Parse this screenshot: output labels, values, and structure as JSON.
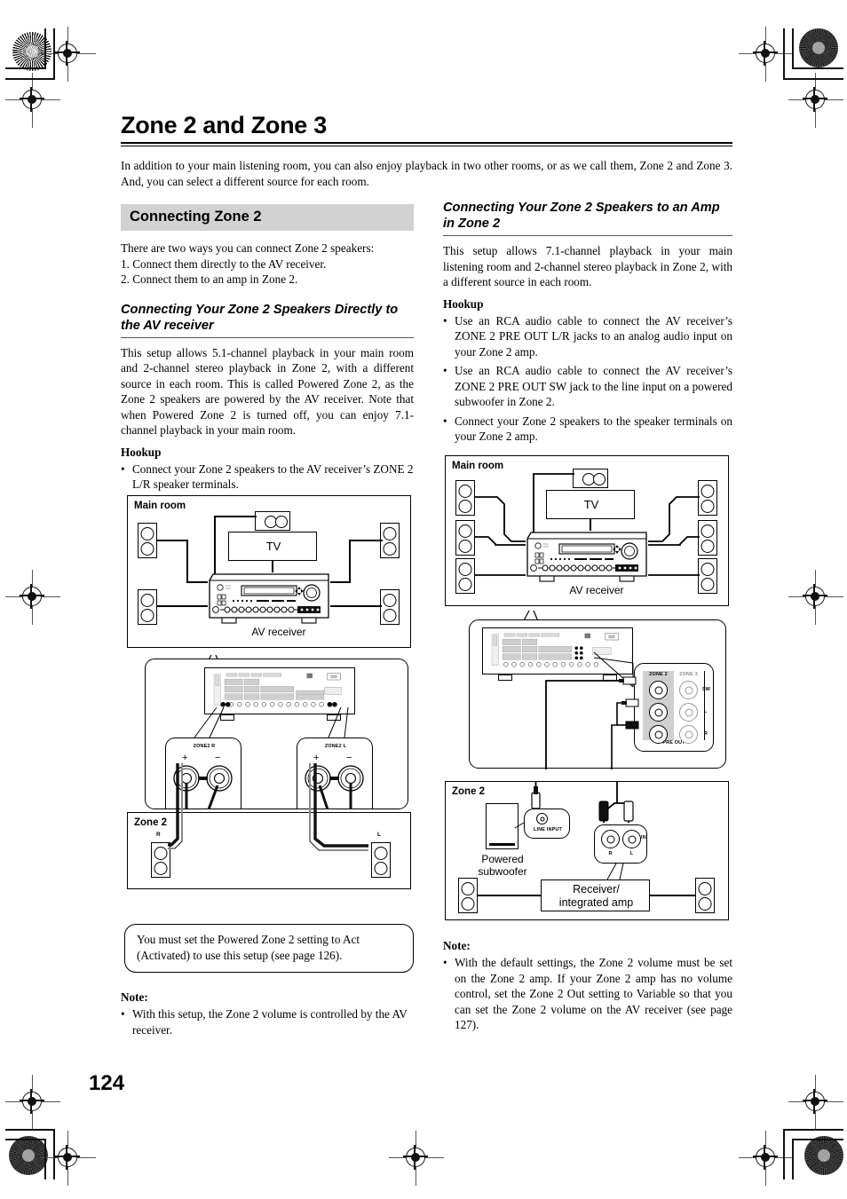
{
  "page": {
    "number": "124",
    "title": "Zone 2 and Zone 3",
    "intro": "In addition to your main listening room, you can also enjoy playback in two other rooms, or as we call them, Zone 2 and Zone 3. And, you can select a different source for each room."
  },
  "left_column": {
    "section_heading": "Connecting Zone 2",
    "intro_line": "There are two ways you can connect Zone 2 speakers:",
    "list": [
      "1. Connect them directly to the AV receiver.",
      "2. Connect them to an amp in Zone 2."
    ],
    "subheading": "Connecting Your Zone 2 Speakers Directly to the AV receiver",
    "body": "This setup allows 5.1-channel playback in your main room and 2-channel stereo playback in Zone 2, with a different source in each room. This is called Powered Zone 2, as the Zone 2 speakers are powered by the AV receiver. Note that when Powered Zone 2 is turned off, you can enjoy 7.1-channel playback in your main room.",
    "hookup_label": "Hookup",
    "hookup_items": [
      "Connect your Zone 2 speakers to the AV receiver’s ZONE 2 L/R speaker terminals."
    ],
    "callout": "You must set the Powered Zone 2 setting to Act (Activated) to use this setup (see page 126).",
    "note_label": "Note:",
    "note_items": [
      "With this setup, the Zone 2 volume is controlled by the AV receiver."
    ]
  },
  "right_column": {
    "subheading": "Connecting Your Zone 2 Speakers to an Amp in Zone 2",
    "body": "This setup allows 7.1-channel playback in your main listening room and 2-channel stereo playback in Zone 2, with a different source in each room.",
    "hookup_label": "Hookup",
    "hookup_items": [
      "Use an RCA audio cable to connect the AV receiver’s ZONE 2 PRE OUT L/R jacks to an analog audio input on your Zone 2 amp.",
      "Use an RCA audio cable to connect the AV receiver’s ZONE 2 PRE OUT SW jack to the line input on a powered subwoofer in Zone 2.",
      "Connect your Zone 2 speakers to the speaker terminals on your Zone 2 amp."
    ],
    "note_label": "Note:",
    "note_items": [
      "With the default settings, the Zone 2 volume must be set on the Zone 2 amp. If your Zone 2 amp has no volume control, set the Zone 2 Out setting to Variable so that you can set the Zone 2 volume on the AV receiver (see page 127)."
    ]
  },
  "figure_left": {
    "main_room_label": "Main room",
    "tv_label": "TV",
    "receiver_label": "AV receiver",
    "terminal_right_label": "ZONE2 R",
    "terminal_left_label": "ZONE2 L",
    "plus": "+",
    "minus": "−",
    "zone_label": "Zone 2",
    "zone_r": "R",
    "zone_l": "L"
  },
  "figure_right": {
    "main_room_label": "Main room",
    "tv_label": "TV",
    "receiver_label": "AV receiver",
    "preout_zone2": "ZONE 2",
    "preout_zone3": "ZONE 3",
    "preout_label": "PRE OUT",
    "row_sw": "SW",
    "row_l": "L",
    "row_r": "R",
    "zone_label": "Zone 2",
    "line_input": "LINE INPUT",
    "subwoofer_label": "Powered\nsubwoofer",
    "subwoofer_label_1": "Powered",
    "subwoofer_label_2": "subwoofer",
    "amp_label_1": "Receiver/",
    "amp_label_2": "integrated amp",
    "in_label": "IN",
    "in_r": "R",
    "in_l": "L"
  },
  "colors": {
    "section_bar": "#d2d2d2",
    "rule": "#000000",
    "panel_gray": "#e6e6e6"
  }
}
